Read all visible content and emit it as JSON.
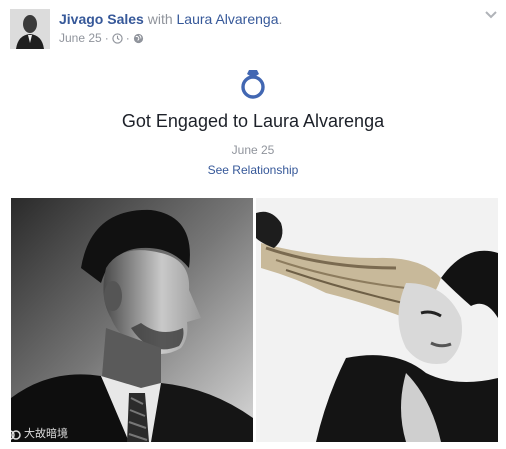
{
  "post": {
    "author_name": "Jivago Sales",
    "with_text": " with ",
    "tagged_name": "Laura Alvarenga",
    "tagged_suffix": ".",
    "date": "June 25",
    "separator": "·",
    "clock_icon": "clock-icon",
    "audience_icon": "globe-icon",
    "menu_icon": "chevron-down-icon"
  },
  "life_event": {
    "icon": "ring-icon",
    "title": "Got Engaged to Laura Alvarenga",
    "date": "June 25",
    "link_label": "See Relationship"
  },
  "photos": [
    {
      "subject": "man-portrait"
    },
    {
      "subject": "woman-portrait"
    }
  ],
  "watermark": {
    "text": "大故暗境",
    "logo": "watermark-logo"
  },
  "colors": {
    "link": "#365899",
    "text": "#1d2129",
    "meta": "#90949c",
    "accent": "#4267b2"
  }
}
